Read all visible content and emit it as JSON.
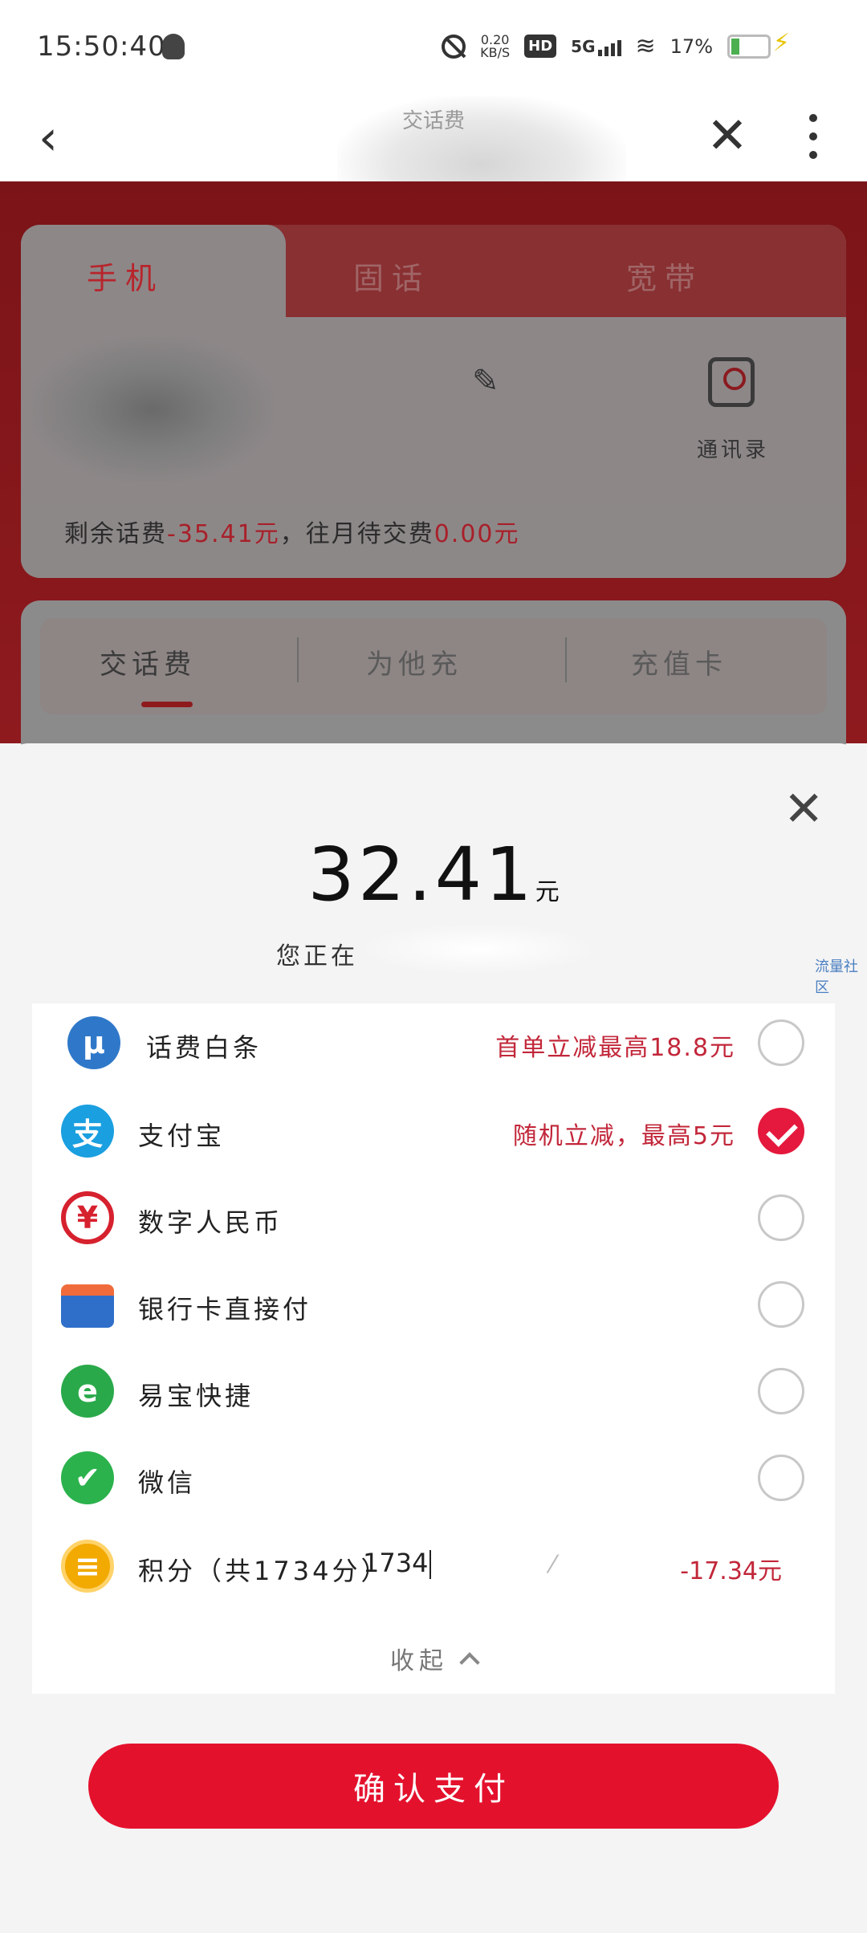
{
  "status_bar": {
    "time": "15:50:40",
    "net_speed_value": "0.20",
    "net_speed_unit": "KB/S",
    "hd": "HD",
    "network": "5G",
    "battery": "17%"
  },
  "header": {
    "title": "交话费"
  },
  "top_tabs": [
    {
      "label": "手机"
    },
    {
      "label": "固话"
    },
    {
      "label": "宽带"
    }
  ],
  "account": {
    "contacts_label": "通讯录",
    "balance_prefix": "剩余话费",
    "balance_value": "-35.41元",
    "balance_mid": "，往月待交费",
    "pending_value": "0.00元"
  },
  "sub_tabs": [
    {
      "label": "交话费"
    },
    {
      "label": "为他充"
    },
    {
      "label": "充值卡"
    }
  ],
  "sheet": {
    "amount": "32.41",
    "unit": "元",
    "paying_to": "您正在",
    "watermark": "流量社区"
  },
  "payment_methods": [
    {
      "label": "话费白条",
      "promo": "首单立减最高18.8元",
      "icon": "baitiao-icon",
      "color": "#2f78c9",
      "glyph": "μ",
      "selected": false
    },
    {
      "label": "支付宝",
      "promo": "随机立减，最高5元",
      "icon": "alipay-icon",
      "color": "#1a9fe0",
      "glyph": "支",
      "selected": true
    },
    {
      "label": "数字人民币",
      "promo": "",
      "icon": "digital-rmb-icon",
      "color": "#d6212e",
      "glyph": "¥",
      "selected": false
    },
    {
      "label": "银行卡直接付",
      "promo": "",
      "icon": "bank-card-icon",
      "color": "#2f6fc9",
      "glyph": "▭",
      "selected": false
    },
    {
      "label": "易宝快捷",
      "promo": "",
      "icon": "yeepay-icon",
      "color": "#2aa94a",
      "glyph": "e",
      "selected": false
    },
    {
      "label": "微信",
      "promo": "",
      "icon": "wechat-pay-icon",
      "color": "#2bb24c",
      "glyph": "✔",
      "selected": false
    }
  ],
  "points": {
    "label": "积分（共1734分）",
    "input_value": "1734",
    "deduction": "-17.34元",
    "icon": "points-coin-icon",
    "color": "#f2a900"
  },
  "collapse_label": "收起",
  "confirm_label": "确认支付"
}
